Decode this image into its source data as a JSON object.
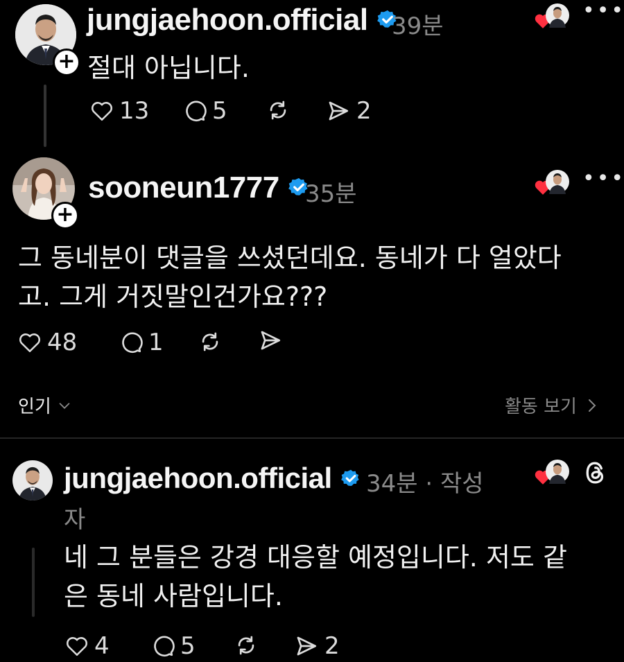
{
  "posts": [
    {
      "username": "jungjaehoon.official",
      "time": "39분",
      "text": "절대 아닙니다.",
      "likes": "13",
      "replies": "5",
      "shares": "2"
    },
    {
      "username": "sooneun1777",
      "time": "35분",
      "text_line1": "그 동네분이 댓글을 쓰셨던데요. 동네가 다 얼았다",
      "text_line2": "고. 그게 거짓말인건가요???",
      "likes": "48",
      "replies": "1"
    },
    {
      "username": "jungjaehoon.official",
      "time": "34분 · 작성",
      "time_cont": "자",
      "text_line1": "네 그 분들은 강경 대응할 예정입니다. 저도 같",
      "text_line2": "은 동네 사람입니다.",
      "likes": "4",
      "replies": "5",
      "shares": "2"
    }
  ],
  "sort": {
    "label": "인기",
    "activity": "활동 보기"
  },
  "colors": {
    "background": "#000000",
    "verified": "#1d9bf0",
    "like_red": "#ff3040"
  },
  "icons": [
    "verified-badge-icon",
    "heart-icon",
    "comment-icon",
    "repost-icon",
    "share-icon",
    "more-icon",
    "threads-logo-icon",
    "chevron-down-icon",
    "chevron-right-icon"
  ]
}
